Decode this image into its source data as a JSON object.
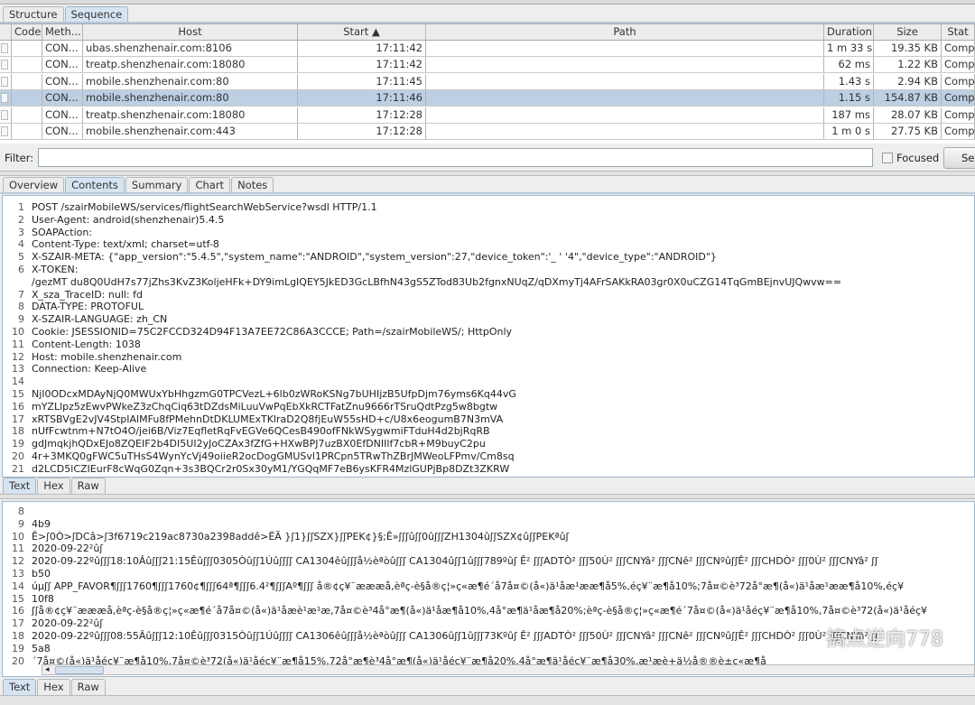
{
  "session_tabs": [
    {
      "label": "Structure",
      "selected": false
    },
    {
      "label": "Sequence",
      "selected": true
    }
  ],
  "table": {
    "columns": [
      "",
      "Code",
      "Meth...",
      "Host",
      "Start ▲",
      "Path",
      "Duration",
      "Size",
      "Stat"
    ],
    "rows": [
      {
        "code": "",
        "method": "CON...",
        "host": "ubas.shenzhenair.com:8106",
        "start": "17:11:42",
        "path": "",
        "duration": "1 m 33 s",
        "size": "19.35 KB",
        "status": "Compl"
      },
      {
        "code": "",
        "method": "CON...",
        "host": "treatp.shenzhenair.com:18080",
        "start": "17:11:42",
        "path": "",
        "duration": "62 ms",
        "size": "1.22 KB",
        "status": "Compl"
      },
      {
        "code": "",
        "method": "CON...",
        "host": "mobile.shenzhenair.com:80",
        "start": "17:11:45",
        "path": "",
        "duration": "1.43 s",
        "size": "2.94 KB",
        "status": "Compl"
      },
      {
        "code": "",
        "method": "CON...",
        "host": "mobile.shenzhenair.com:80",
        "start": "17:11:46",
        "path": "",
        "duration": "1.15 s",
        "size": "154.87 KB",
        "status": "Compl",
        "selected": true
      },
      {
        "code": "",
        "method": "CON...",
        "host": "treatp.shenzhenair.com:18080",
        "start": "17:12:28",
        "path": "",
        "duration": "187 ms",
        "size": "28.07 KB",
        "status": "Compl"
      },
      {
        "code": "",
        "method": "CON...",
        "host": "mobile.shenzhenair.com:443",
        "start": "17:12:28",
        "path": "",
        "duration": "1 m 0 s",
        "size": "27.75 KB",
        "status": "Compl"
      }
    ]
  },
  "filter": {
    "label": "Filter:",
    "value": "",
    "focused_label": "Focused",
    "focused_checked": false,
    "settings_label": "Se"
  },
  "detail_tabs": [
    {
      "label": "Overview"
    },
    {
      "label": "Contents",
      "selected": true
    },
    {
      "label": "Summary"
    },
    {
      "label": "Chart"
    },
    {
      "label": "Notes"
    }
  ],
  "request": {
    "lines": [
      {
        "n": "1",
        "t": "POST /szairMobileWS/services/flightSearchWebService?wsdl HTTP/1.1"
      },
      {
        "n": "2",
        "t": "User-Agent: android(shenzhenair)5.4.5"
      },
      {
        "n": "3",
        "t": "SOAPAction:"
      },
      {
        "n": "4",
        "t": "Content-Type: text/xml; charset=utf-8"
      },
      {
        "n": "5",
        "t": "X-SZAIR-META: {\"app_version\":\"5.4.5\",\"system_name\":\"ANDROID\",\"system_version\":27,\"device_token\":'_                              ' '4\",\"device_type\":\"ANDROID\"}"
      },
      {
        "n": "6",
        "t": "X-TOKEN:"
      },
      {
        "n": "",
        "t": "/gezMT                    du8Q0UdH7s77jZhs3KvZ3KoljeHFk+DY9imLgIQEY5JkED3GcLBfhN43gS5ZTod83Ub2fgnxNUqZ/qDXmyTj4AFrSAKkRA03gr0X0uCZG14TqGmBEjnvUJQwvw=="
      },
      {
        "n": "7",
        "t": "X_sza_TraceID: null:                                                                                   fd"
      },
      {
        "n": "8",
        "t": "DATA-TYPE: PROTOFUL"
      },
      {
        "n": "9",
        "t": "X-SZAIR-LANGUAGE: zh_CN"
      },
      {
        "n": "10",
        "t": "Cookie: JSESSIONID=75C2FCCD324D94F13A7EE72C86A3CCCE; Path=/szairMobileWS/; HttpOnly"
      },
      {
        "n": "11",
        "t": "Content-Length: 1038"
      },
      {
        "n": "12",
        "t": "Host: mobile.shenzhenair.com"
      },
      {
        "n": "13",
        "t": "Connection: Keep-Alive"
      },
      {
        "n": "14",
        "t": ""
      },
      {
        "n": "15",
        "t": "NjI0ODcxMDAyNjQ0MWUxYbHhgzmG0TPCVezL+6lb0zWRoKSNg7bUHIjzB5UfpDjm76yms6Kq44vG"
      },
      {
        "n": "16",
        "t": "mYZLlpz5zEwvPWkeZ3zChqCiq63tDZdsMiLuuVwPqEbXkRCTFatZnu9666rTSruQdtPzg5w8bgtw"
      },
      {
        "n": "17",
        "t": "xRTSBVgE2vJV4StpIAlMFu8fPMehnDtDKLUMExTKlraD2Q8fjEuW55sHD+c/U8x6eogumB7N3mVA"
      },
      {
        "n": "18",
        "t": "nUfFcwtnm+N7tO4O/jei6B/Viz7EqfletRqFvEGVe6QCesB490ofFNkWSygwmiFTduH4d2bjRqRB"
      },
      {
        "n": "19",
        "t": "gdJmqkjhQDxEJo8ZQEIF2b4DI5UI2yJoCZAx3fZfG+HXwBPJ7uzBX0EfDNIIlf7cbR+M9buyC2pu"
      },
      {
        "n": "20",
        "t": "4r+3MKQ0gFWC5uTHsS4WynYcVj49oiieR2ocDogGMUSvl1PRCpn5TRwThZBrJMWeoLFPmv/Cm8sq"
      },
      {
        "n": "21",
        "t": "d2LCD5lCZIEurF8cWqG0Zqn+3s3BQCr2r0Sx30yM1/YGQqMF7eB6ysKFR4MzlGUPjBp8DZt3ZKRW"
      }
    ]
  },
  "view_tabs_request": [
    {
      "label": "Text",
      "selected": true
    },
    {
      "label": "Hex"
    },
    {
      "label": "Raw"
    }
  ],
  "response": {
    "lines": [
      {
        "n": "8",
        "t": ""
      },
      {
        "n": "9",
        "t": "4b9"
      },
      {
        "n": "10",
        "t": "Ê>ʃ0Ò>ʃDCâ>ʃ3f6719c219ac8730a2398addê>ËÃ          }ʃ1}ʃʃSZX}ʃʃPEK¢}§;Ê»ʃʃʃûʃʃ0ûʃʃʃZH1304ûʃʃSZX¢ûʃʃPEKªûʃ"
      },
      {
        "n": "11",
        "t": "2020-09-22²ûʃ"
      },
      {
        "n": "12",
        "t": "2020-09-22ºûʃʃʃ18:10Âûʃʃʃ21:15Êûʃʃʃ0305Òûʃʃ1Úûʃʃʃʃ CA1304êûʃʃʃå½èªòûʃʃʃ CA1304ûʃʃ1ûʃʃʃ789ºûʃ Ê² ʃʃʃADTÒ² ʃʃʃ50Ù² ʃʃʃCNYâ² ʃʃʃCNê² ʃʃʃCNºûʃʃÊ² ʃʃʃCHDÒ² ʃʃʃ0Ù² ʃʃʃCNYâ² ʃʃ"
      },
      {
        "n": "13",
        "t": "b50"
      },
      {
        "n": "14",
        "t": "úµʃʃ APP_FAVOR¶ʃʃʃ1760¶ʃʃʃ1760¢¶ʃʃʃ64ª¶ʃʃʃ6.4²¶ʃʃʃAº¶ʃʃʃ å®¢ç¥¨æææå,èªç-è§å®ç¦»ç«æ¶é´å7å¤©(å«)ä¹åæ¹ææ¶å5%,éç¥¨æ¶å10%;7å¤©è³72å°æ¶(å«)ä¹åæ¹ææ¶å10%,éç¥"
      },
      {
        "n": "15",
        "t": "10f8"
      },
      {
        "n": "16",
        "t": "ʃʃå®¢ç¥¨æææå,èªç-è§å®ç¦»ç«æ¶é´å7å¤©(å«)ä¹åæè¹æ¹æ,7å¤©è³4å°æ¶(å«)ä¹åæ¶å10%,4å°æ¶ä¹åæ¶å20%;èªç-è§å®ç¦»ç«æ¶é´7å¤©(å«)ä¹åéç¥¨æ¶å10%,7å¤©è³72(å«)ä¹åéç¥"
      },
      {
        "n": "17",
        "t": "2020-09-22²ûʃ"
      },
      {
        "n": "18",
        "t": "2020-09-22ºûʃʃʃ08:55Âûʃʃʃ12:10Êûʃʃʃ0315Òûʃʃ1Úûʃʃʃʃ CA1306êûʃʃʃå½èªòûʃʃʃ CA1306ûʃʃ1ûʃʃʃ73Kºûʃ Ê² ʃʃʃADTÒ² ʃʃʃ50Ù² ʃʃʃCNYâ² ʃʃʃCNê² ʃʃʃCNºûʃʃÊ² ʃʃʃCHDÒ² ʃʃʃ0Ù² ʃʃʃCNYâ² ʃʃ"
      },
      {
        "n": "19",
        "t": "5a8"
      },
      {
        "n": "20",
        "t": "´7å¤©(å«)ä¹åéç¥¨æ¶å10%,7å¤©è³72(å«)ä¹åéç¥¨æ¶å15%,72å°æ¶è³4å°æ¶(å«)ä¹åéç¥¨æ¶å20%,4å°æ¶ä¹åéç¥¨æ¶å30%,æ¹æè+ä½å®®è±ç«æ¶å"
      }
    ]
  },
  "view_tabs_response": [
    {
      "label": "Text",
      "selected": true
    },
    {
      "label": "Hex"
    },
    {
      "label": "Raw"
    }
  ],
  "watermark": "搞点逆向778"
}
